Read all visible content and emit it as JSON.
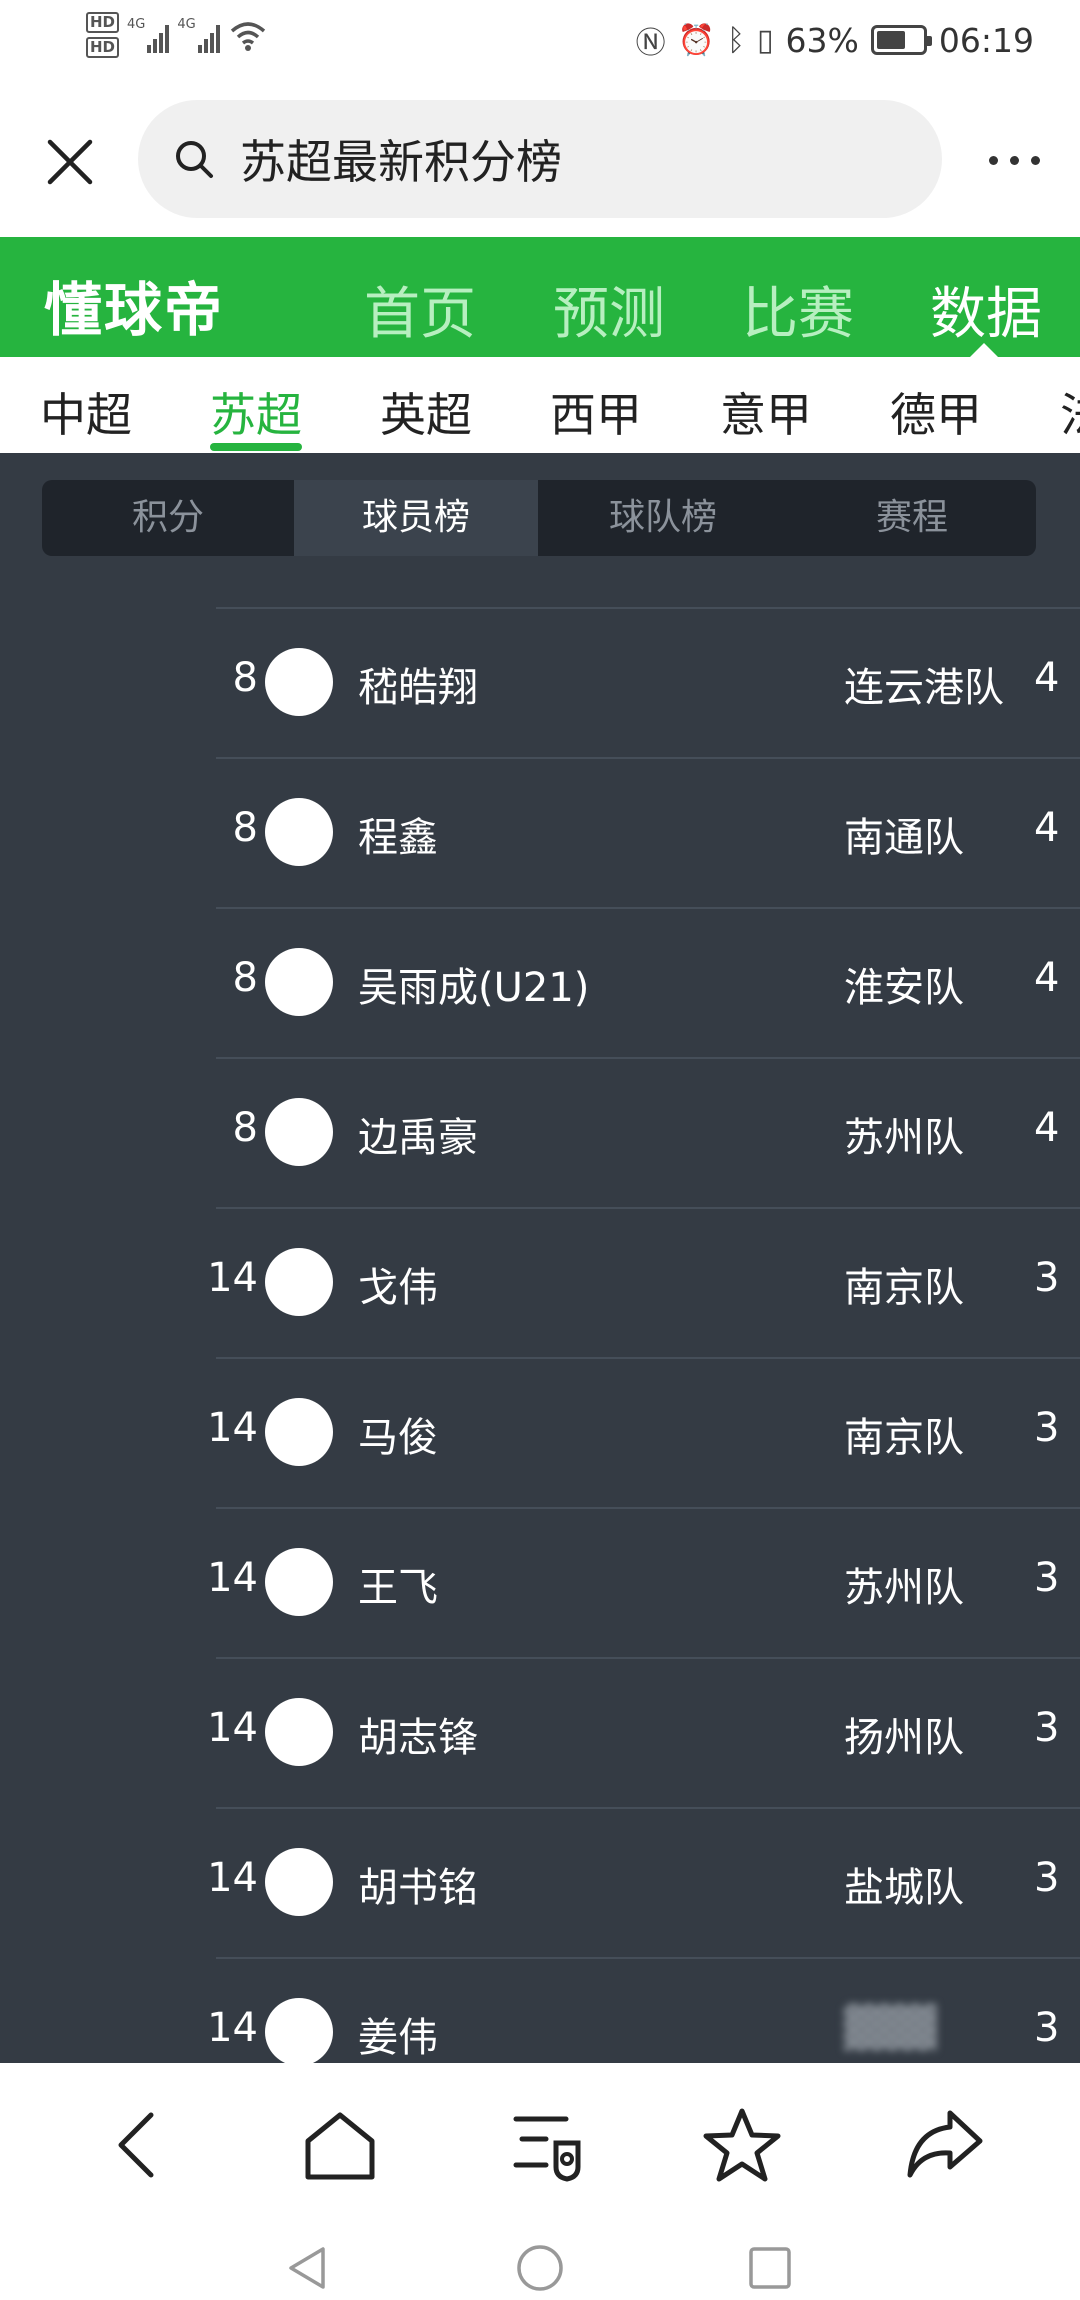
{
  "status_bar": {
    "hd_top": "HD",
    "hd_bottom": "HD",
    "net1": "4G",
    "net2": "4G",
    "battery_text": "63%",
    "battery_level": 0.63,
    "time": "06:19"
  },
  "search": {
    "query": "苏超最新积分榜"
  },
  "brand": {
    "logo": "懂球帝",
    "nav": [
      "首页",
      "预测",
      "比赛",
      "数据"
    ],
    "active_nav": "数据"
  },
  "leagues": {
    "items": [
      "中超",
      "苏超",
      "英超",
      "西甲",
      "意甲",
      "德甲",
      "法"
    ],
    "active": "苏超"
  },
  "sub_tabs": {
    "items": [
      "积分",
      "球员榜",
      "球队榜",
      "赛程"
    ],
    "active": "球员榜"
  },
  "players": [
    {
      "rank": "8",
      "name": "嵇皓翔",
      "team": "连云港队",
      "goals": "4"
    },
    {
      "rank": "8",
      "name": "程鑫",
      "team": "南通队",
      "goals": "4"
    },
    {
      "rank": "8",
      "name": "吴雨成(U21)",
      "team": "淮安队",
      "goals": "4"
    },
    {
      "rank": "8",
      "name": "边禹豪",
      "team": "苏州队",
      "goals": "4"
    },
    {
      "rank": "14",
      "name": "戈伟",
      "team": "南京队",
      "goals": "3"
    },
    {
      "rank": "14",
      "name": "马俊",
      "team": "南京队",
      "goals": "3"
    },
    {
      "rank": "14",
      "name": "王飞",
      "team": "苏州队",
      "goals": "3"
    },
    {
      "rank": "14",
      "name": "胡志锋",
      "team": "扬州队",
      "goals": "3"
    },
    {
      "rank": "14",
      "name": "胡书铭",
      "team": "盐城队",
      "goals": "3"
    },
    {
      "rank": "14",
      "name": "姜伟",
      "team": "",
      "goals": "3"
    }
  ],
  "colors": {
    "brand_green": "#26b43f",
    "list_bg": "#343b44"
  }
}
